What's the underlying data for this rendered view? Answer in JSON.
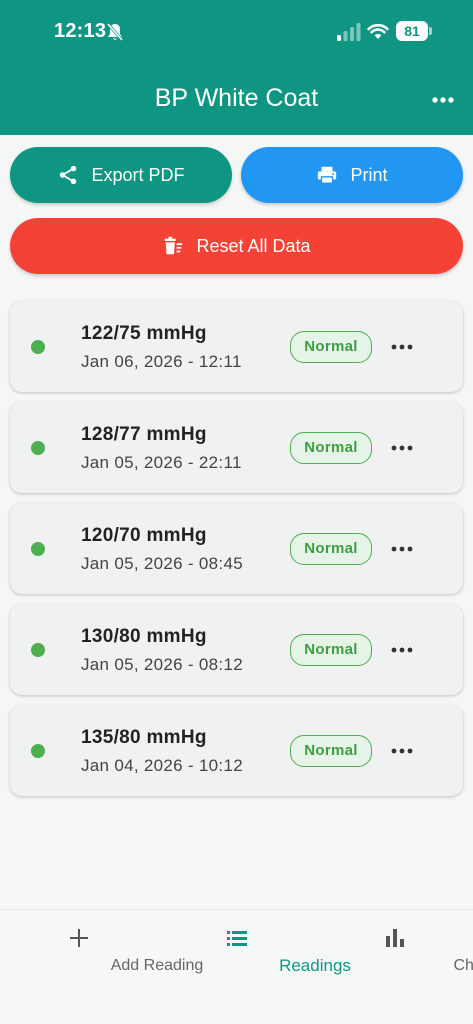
{
  "status_bar": {
    "time": "12:13",
    "battery": "81"
  },
  "header": {
    "title": "BP White Coat"
  },
  "actions": {
    "export_label": "Export PDF",
    "print_label": "Print",
    "reset_label": "Reset All Data"
  },
  "readings": [
    {
      "value": "122/75 mmHg",
      "date": "Jan 06, 2026 - 12:11",
      "status": "Normal"
    },
    {
      "value": "128/77 mmHg",
      "date": "Jan 05, 2026 - 22:11",
      "status": "Normal"
    },
    {
      "value": "120/70 mmHg",
      "date": "Jan 05, 2026 - 08:45",
      "status": "Normal"
    },
    {
      "value": "130/80 mmHg",
      "date": "Jan 05, 2026 - 08:12",
      "status": "Normal"
    },
    {
      "value": "135/80 mmHg",
      "date": "Jan 04, 2026 - 10:12",
      "status": "Normal"
    }
  ],
  "bottom_nav": {
    "add_label": "Add Reading",
    "readings_label": "Readings",
    "chart_label": "Chart"
  },
  "colors": {
    "header": "#0f9683",
    "print": "#2296f3",
    "reset": "#f44336",
    "normal": "#4caf50"
  },
  "icons": [
    "bell-muted-icon",
    "signal-icon",
    "wifi-icon",
    "more-horizontal-icon",
    "share-icon",
    "printer-icon",
    "trash-icon",
    "plus-icon",
    "list-icon",
    "bar-chart-icon"
  ]
}
